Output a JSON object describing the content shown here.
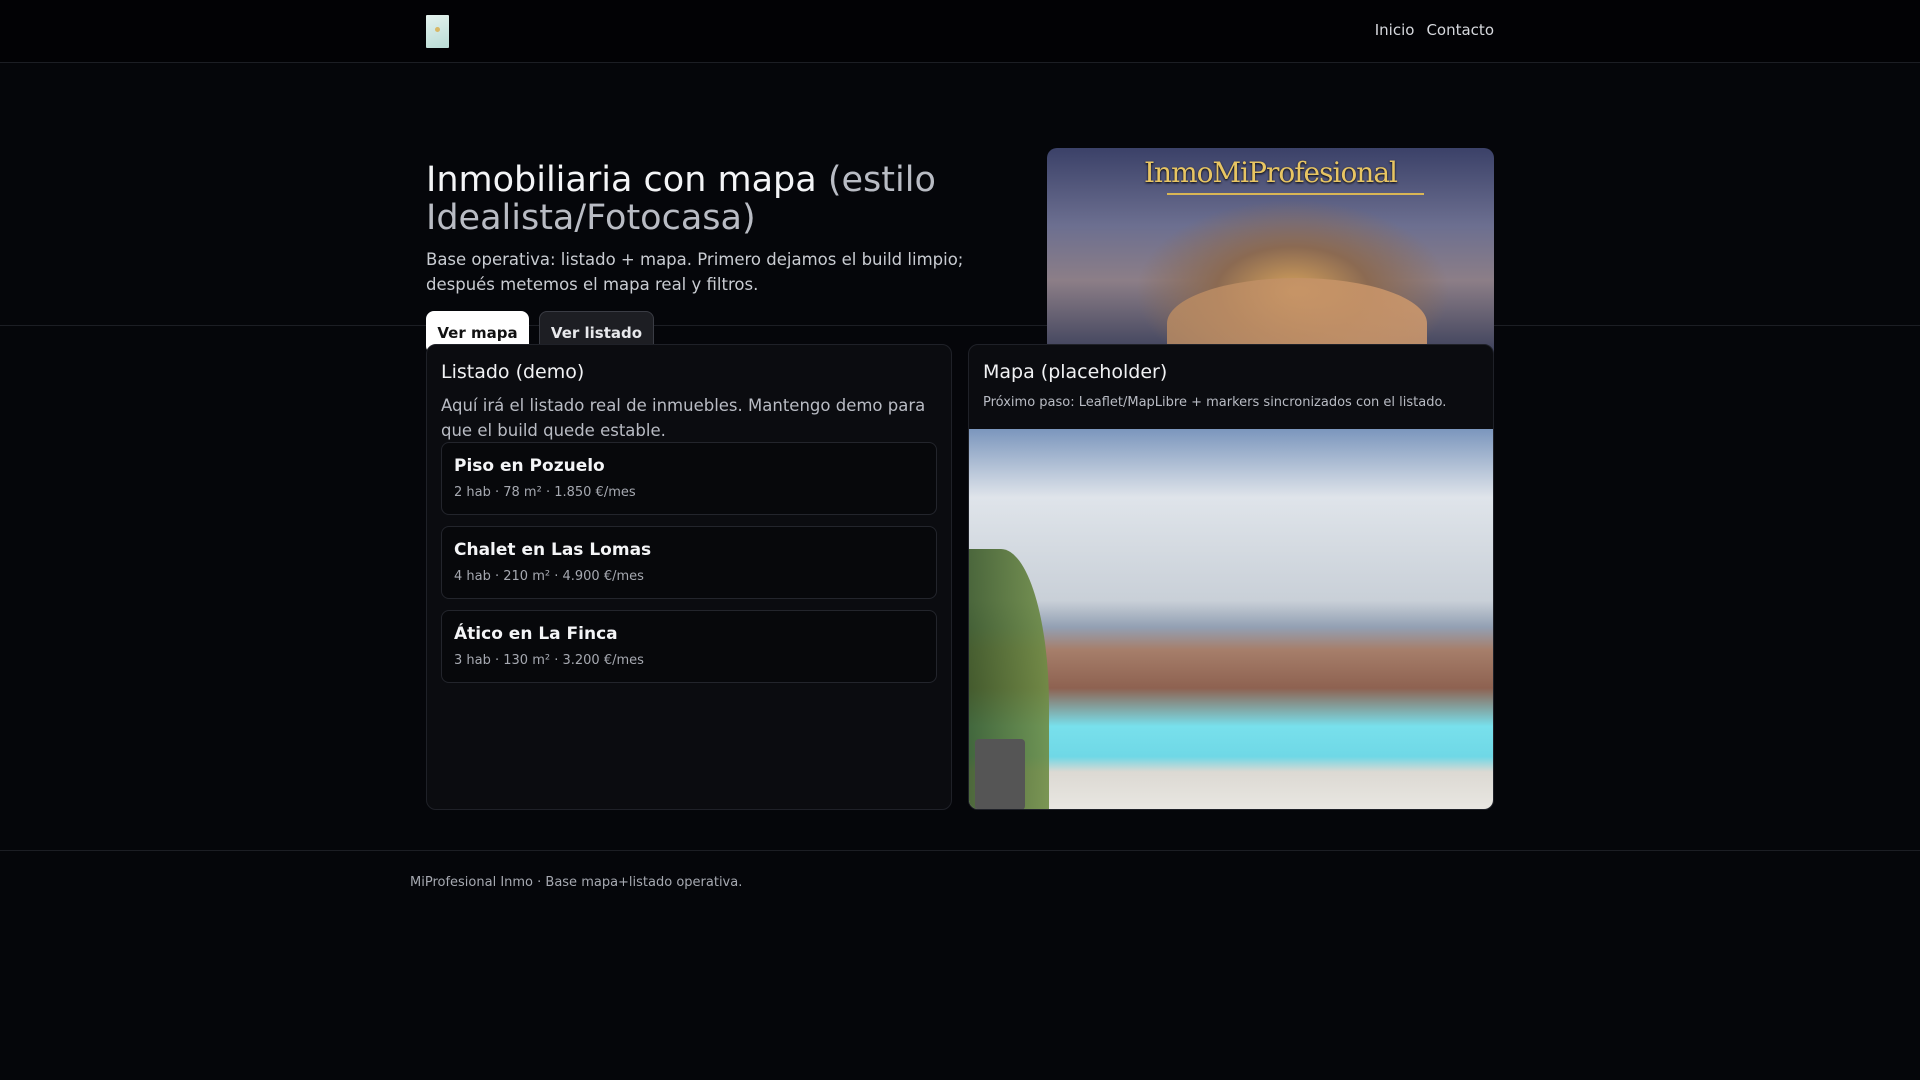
{
  "nav": {
    "items": [
      "Inicio",
      "Contacto"
    ]
  },
  "hero": {
    "title_main": "Inmobiliaria con mapa",
    "title_muted": "(estilo Idealista/Fotocasa)",
    "description": "Base operativa: listado + mapa. Primero dejamos el build limpio; después metemos el mapa real y filtros.",
    "primary_button": "Ver mapa",
    "secondary_button": "Ver listado",
    "image_brand": "InmoMiProfesional"
  },
  "listing": {
    "title": "Listado (demo)",
    "description": "Aquí irá el listado real de inmuebles. Mantengo demo para que el build quede estable.",
    "items": [
      {
        "title": "Piso en Pozuelo",
        "details": "2 hab · 78 m² · 1.850 €/mes"
      },
      {
        "title": "Chalet en Las Lomas",
        "details": "4 hab · 210 m² · 4.900 €/mes"
      },
      {
        "title": "Ático en La Finca",
        "details": "3 hab · 130 m² · 3.200 €/mes"
      }
    ]
  },
  "map": {
    "title": "Mapa (placeholder)",
    "description": "Próximo paso: Leaflet/MapLibre + markers sincronizados con el listado."
  },
  "footer": {
    "text": "MiProfesional Inmo · Base mapa+listado operativa."
  }
}
